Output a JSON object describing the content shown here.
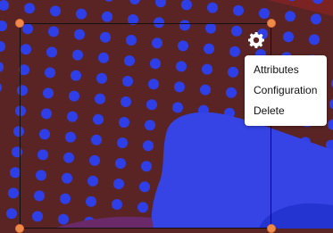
{
  "canvas": {
    "background_color": "#5a2424",
    "dot_color": "#2f3fe8",
    "blob_color": "#3442e6",
    "accent_band_color": "#7a2222"
  },
  "selection": {
    "handle_color": "#f08a4b",
    "border_color": "#111111"
  },
  "toolbar": {
    "settings_icon": "gear-icon"
  },
  "context_menu": {
    "items": [
      {
        "label": "Attributes"
      },
      {
        "label": "Configuration"
      },
      {
        "label": "Delete"
      }
    ]
  }
}
